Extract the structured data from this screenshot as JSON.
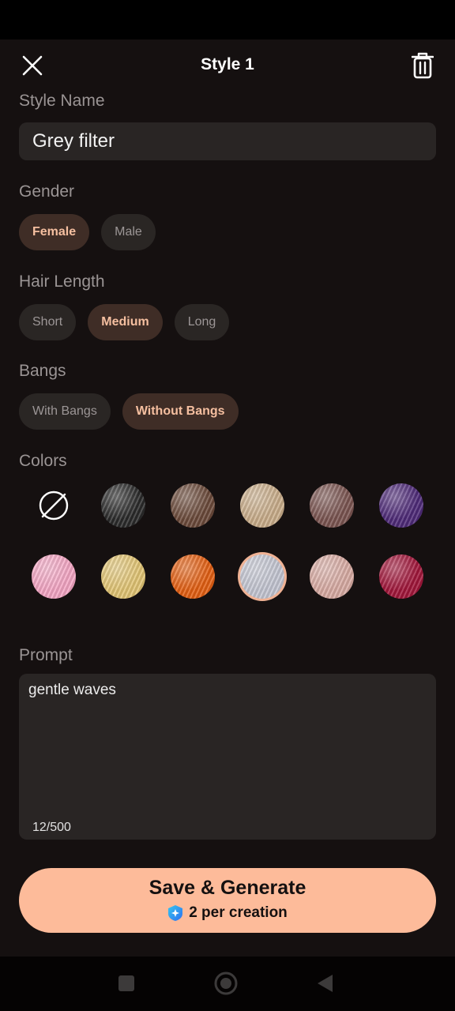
{
  "header": {
    "title": "Style 1",
    "close_icon": "close-icon",
    "delete_icon": "trash-icon"
  },
  "style_name": {
    "label": "Style Name",
    "value": "Grey filter"
  },
  "gender": {
    "label": "Gender",
    "options": [
      "Female",
      "Male"
    ],
    "selected": "Female"
  },
  "hair_length": {
    "label": "Hair Length",
    "options": [
      "Short",
      "Medium",
      "Long"
    ],
    "selected": "Medium"
  },
  "bangs": {
    "label": "Bangs",
    "options": [
      "With Bangs",
      "Without Bangs"
    ],
    "selected": "Without Bangs"
  },
  "colors": {
    "label": "Colors",
    "swatches": [
      {
        "name": "none",
        "hex": "none"
      },
      {
        "name": "black",
        "hex": "#2a2a2a"
      },
      {
        "name": "brown",
        "hex": "#6b4a3a"
      },
      {
        "name": "blonde-beige",
        "hex": "#c9ad8a"
      },
      {
        "name": "mauve-brown",
        "hex": "#7a5450"
      },
      {
        "name": "purple",
        "hex": "#4e2a78"
      },
      {
        "name": "pink",
        "hex": "#f4a6c4"
      },
      {
        "name": "golden-blonde",
        "hex": "#e2c574"
      },
      {
        "name": "orange",
        "hex": "#e35f12"
      },
      {
        "name": "grey",
        "hex": "#c4c6d2"
      },
      {
        "name": "rose-beige",
        "hex": "#d8aba3"
      },
      {
        "name": "crimson",
        "hex": "#a1163a"
      }
    ],
    "selected": "grey"
  },
  "prompt": {
    "label": "Prompt",
    "value": "gentle waves",
    "count": "12/500"
  },
  "generate": {
    "label": "Save & Generate",
    "cost": "2 per creation",
    "accent": "#fdbb9a"
  },
  "nav": {
    "icons": [
      "recent-apps-icon",
      "home-icon",
      "back-icon"
    ]
  }
}
